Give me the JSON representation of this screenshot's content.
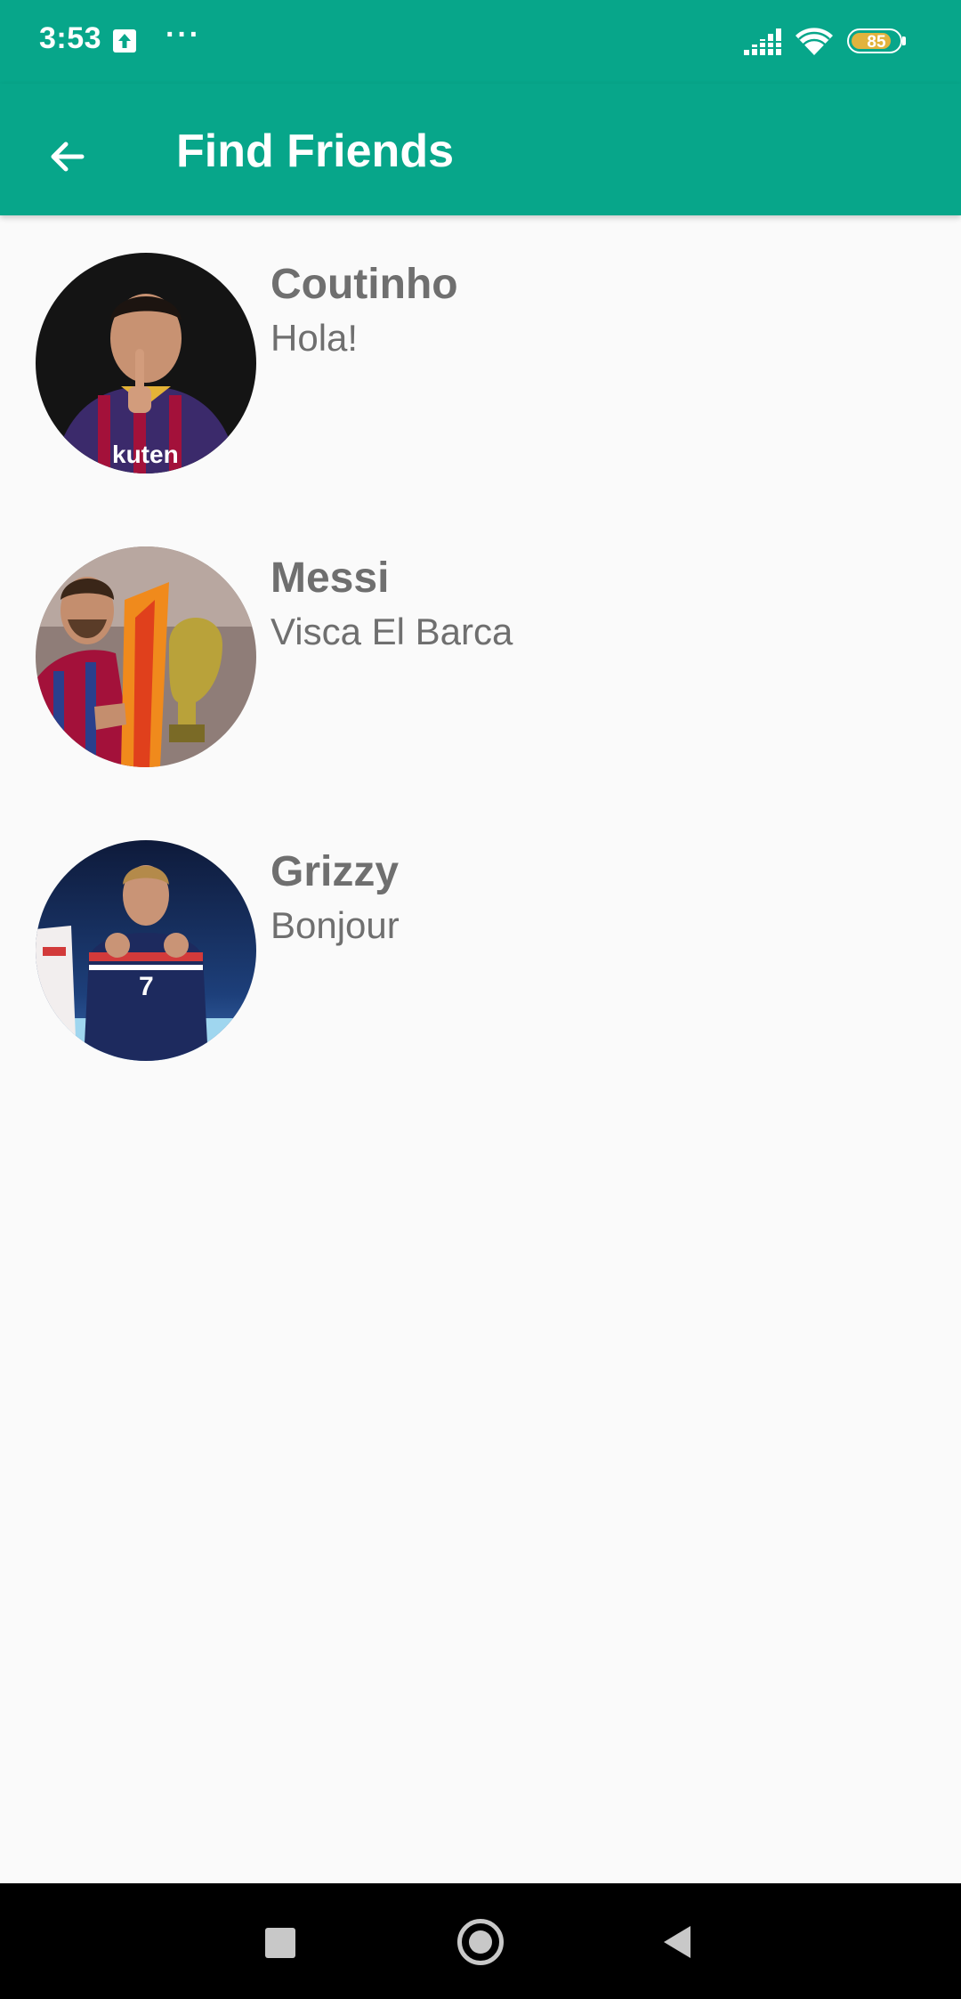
{
  "status_bar": {
    "time": "3:53",
    "more_indicator": "···",
    "battery_level": "85",
    "battery_fraction": 0.85,
    "icons": [
      "upload-icon",
      "signal-icon",
      "wifi-icon",
      "battery-icon"
    ]
  },
  "app_bar": {
    "title": "Find Friends",
    "back_icon": "arrow-left-icon"
  },
  "friends": [
    {
      "name": "Coutinho",
      "status": "Hola!"
    },
    {
      "name": "Messi",
      "status": "Visca El Barca"
    },
    {
      "name": "Grizzy",
      "status": "Bonjour"
    }
  ],
  "nav_bar": {
    "icons": [
      "recents-square-icon",
      "home-circle-icon",
      "back-triangle-icon"
    ]
  },
  "colors": {
    "primary": "#07a68a",
    "background": "#fafafa",
    "text_secondary": "#6f6f6f",
    "nav_bar": "#000000",
    "battery_fill": "#e2b33d"
  }
}
